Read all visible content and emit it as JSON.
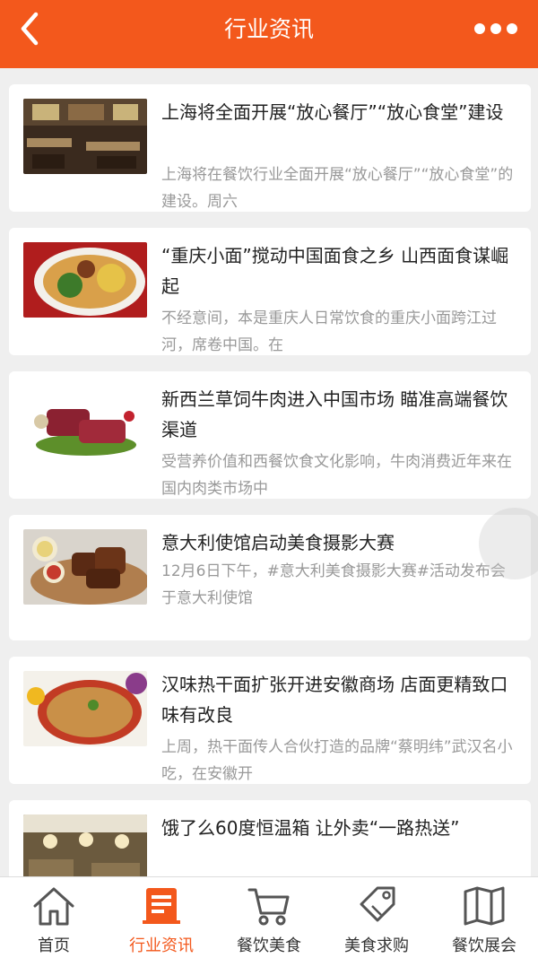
{
  "header": {
    "title": "行业资讯"
  },
  "articles": [
    {
      "title": "上海将全面开展“放心餐厅”“放心食堂”建设",
      "summary": "上海将在餐饮行业全面开展“放心餐厅”“放心食堂”的建设。周六"
    },
    {
      "title": "“重庆小面”搅动中国面食之乡 山西面食谋崛起",
      "summary": "不经意间，本是重庆人日常饮食的重庆小面跨江过河，席卷中国。在"
    },
    {
      "title": "新西兰草饲牛肉进入中国市场 瞄准高端餐饮渠道",
      "summary": "受营养价值和西餐饮食文化影响，牛肉消费近年来在国内肉类市场中"
    },
    {
      "title": "意大利使馆启动美食摄影大赛",
      "summary": "12月6日下午，#意大利美食摄影大赛#活动发布会于意大利使馆"
    },
    {
      "title": "汉味热干面扩张开进安徽商场 店面更精致口味有改良",
      "summary": "上周，热干面传人合伙打造的品牌“蔡明纬”武汉名小吃，在安徽开"
    },
    {
      "title": "饿了么60度恒温箱 让外卖“一路热送”",
      "summary": ""
    }
  ],
  "tabs": [
    {
      "label": "首页",
      "icon": "home-icon",
      "active": false
    },
    {
      "label": "行业资讯",
      "icon": "news-icon",
      "active": true
    },
    {
      "label": "餐饮美食",
      "icon": "cart-icon",
      "active": false
    },
    {
      "label": "美食求购",
      "icon": "tag-icon",
      "active": false
    },
    {
      "label": "餐饮展会",
      "icon": "map-icon",
      "active": false
    }
  ],
  "colors": {
    "accent": "#f3581c",
    "inactive": "#333333"
  }
}
